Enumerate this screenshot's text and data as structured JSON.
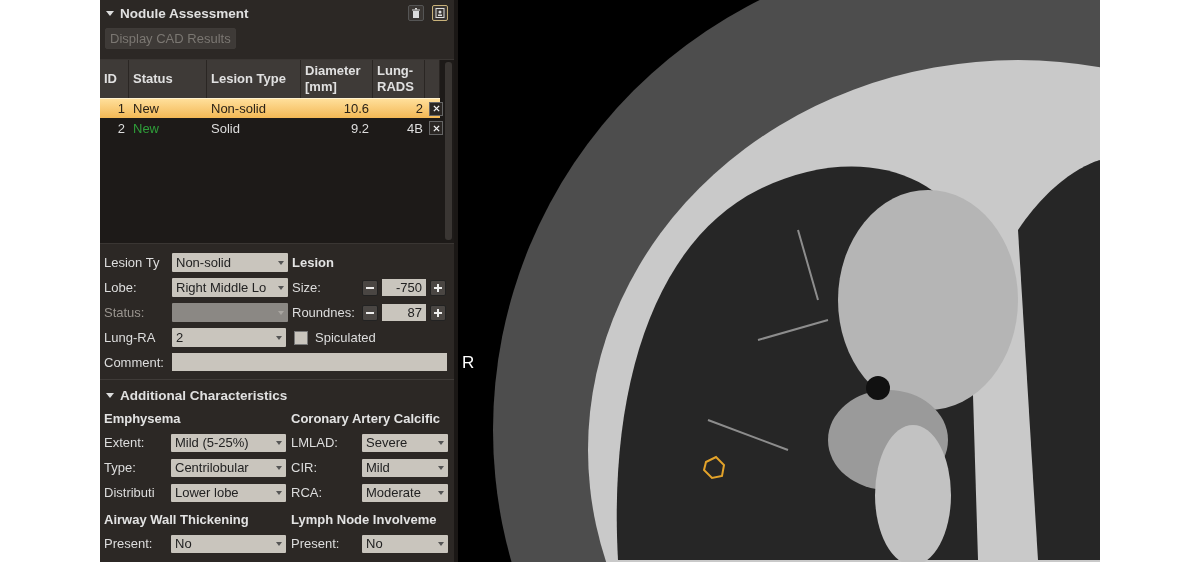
{
  "panel": {
    "title": "Nodule Assessment",
    "expanded": true,
    "cad_button": {
      "label": "Display CAD Results",
      "disabled": true
    },
    "table": {
      "columns": [
        "ID",
        "Status",
        "Lesion Type",
        "Diameter [mm]",
        "Lung-RADS"
      ],
      "rows": [
        {
          "id": "1",
          "status": "New",
          "lesion_type": "Non-solid",
          "diameter": "10.6",
          "lung_rads": "2",
          "selected": true
        },
        {
          "id": "2",
          "status": "New",
          "color": "#2f9e3a",
          "lesion_type": "Solid",
          "diameter": "9.2",
          "lung_rads": "4B",
          "selected": false
        }
      ]
    },
    "form": {
      "fields": [
        {
          "label": "Lesion Ty",
          "value": "Non-solid",
          "disabled": false
        },
        {
          "label": "Lobe:",
          "value": "Right Middle Lo",
          "disabled": false
        },
        {
          "label": "Status:",
          "disabled": true
        },
        {
          "label": "Lung-RA",
          "value": "2",
          "disabled": false
        }
      ],
      "lesion": {
        "title": "Lesion",
        "spinners": [
          {
            "label": "Size:",
            "value": "-750"
          },
          {
            "label": "Roundnes:",
            "value": "87"
          }
        ],
        "spiculated": {
          "label": "Spiculated",
          "checked": false
        }
      },
      "comment": {
        "label": "Comment:"
      }
    },
    "additional": {
      "title": "Additional Characteristics",
      "expanded": true,
      "groups": [
        {
          "title": "Emphysema",
          "fields": [
            {
              "label": "Extent:",
              "value": "Mild (5-25%)"
            },
            {
              "label": "Type:",
              "value": "Centrilobular"
            },
            {
              "label": "Distributi",
              "value": "Lower lobe"
            }
          ]
        },
        {
          "title": "Coronary Artery Calcific",
          "fields": [
            {
              "label": "LMLAD:",
              "value": "Severe"
            },
            {
              "label": "CIR:",
              "value": "Mild"
            },
            {
              "label": "RCA:",
              "value": "Moderate"
            }
          ]
        },
        {
          "title": "Airway Wall Thickening",
          "fields": [
            {
              "label": "Present:",
              "value": "No"
            }
          ]
        },
        {
          "title": "Lymph Node Involveme",
          "fields": [
            {
              "label": "Present:",
              "value": "No"
            }
          ]
        }
      ]
    }
  },
  "viewer": {
    "orientation_label": "R"
  }
}
